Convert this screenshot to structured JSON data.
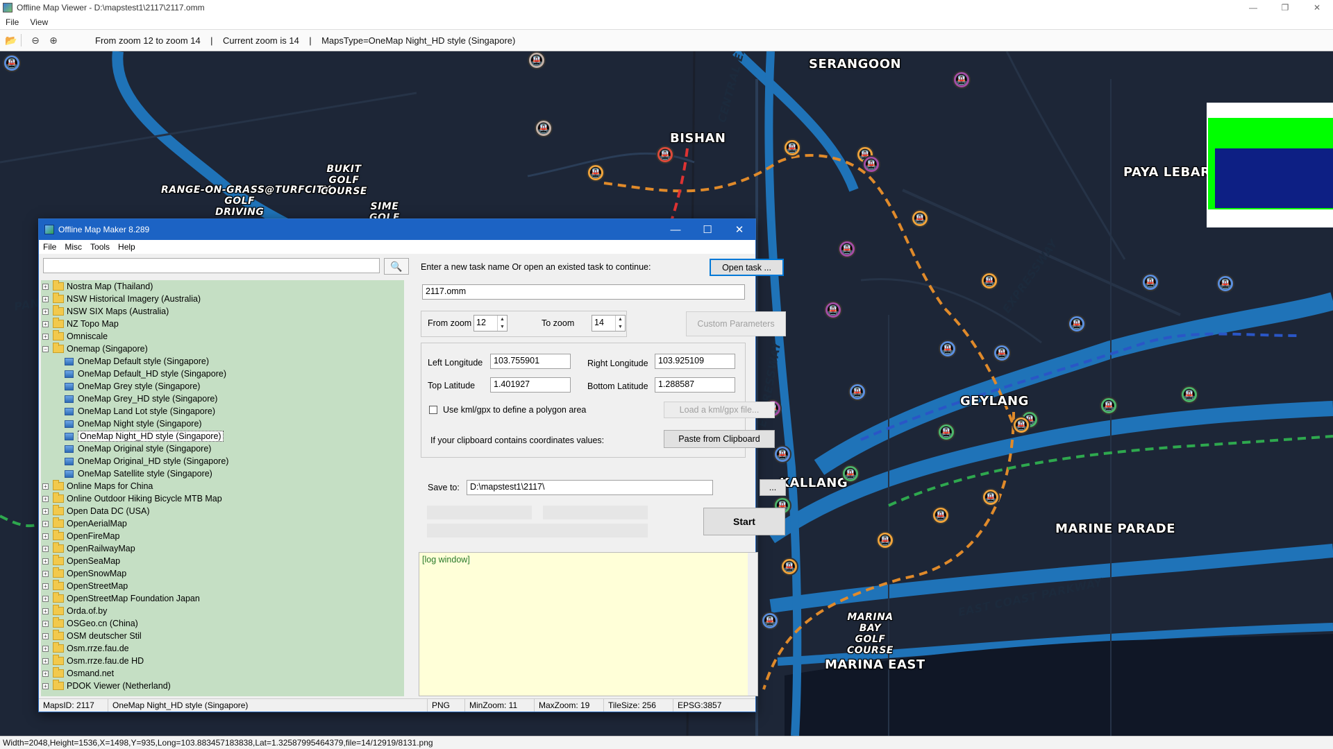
{
  "viewer": {
    "title": "Offline Map Viewer - D:\\mapstest1\\2117\\2117.omm",
    "menu": [
      "File",
      "View"
    ],
    "zoom_info": "From zoom 12 to zoom 14    |    Current zoom is 14    |    MapsType=OneMap Night_HD style (Singapore)",
    "status": "Width=2048,Height=1536,X=1498,Y=935,Long=103.883457183838,Lat=1.32587995464379,file=14/12919/8131.png",
    "window_buttons": [
      "—",
      "❐",
      "✕"
    ]
  },
  "map": {
    "labels": {
      "serangoon": "SERANGOON",
      "bishan": "BISHAN",
      "paya_lebar": "PAYA LEBAR",
      "geylang": "GEYLANG",
      "kallang": "KALLANG",
      "marine_parade": "MARINE PARADE",
      "marina_east": "MARINA EAST",
      "range_on_grass": "RANGE-ON-GRASS@TURFCITY",
      "golf_driving": "GOLF\nDRIVING",
      "bukit_golf": "BUKIT\nGOLF\nCOURSE",
      "sime_golf": "SIME\nGOLF",
      "marina_bay_golf": "MARINA\nBAY\nGOLF\nCOURSE",
      "central_expressway": "CENTRAL EXPRESS",
      "expressway_ne": "EXPRESSWAY",
      "expressway_mid": "EXPRESSWAY",
      "east_coast_parkway": "EAST COAST PARKWAY",
      "pan": "PAN"
    }
  },
  "dialog": {
    "title": "Offline Map Maker 8.289",
    "menu": [
      "File",
      "Misc",
      "Tools",
      "Help"
    ],
    "search_placeholder": "",
    "tree": [
      {
        "label": "Nostra Map (Thailand)",
        "type": "folder"
      },
      {
        "label": "NSW Historical Imagery (Australia)",
        "type": "folder"
      },
      {
        "label": "NSW SIX Maps (Australia)",
        "type": "folder"
      },
      {
        "label": "NZ Topo Map",
        "type": "folder"
      },
      {
        "label": "Omniscale",
        "type": "folder"
      },
      {
        "label": "Onemap (Singapore)",
        "type": "folder-open"
      },
      {
        "label": "OneMap Default style (Singapore)",
        "type": "map"
      },
      {
        "label": "OneMap Default_HD style (Singapore)",
        "type": "map"
      },
      {
        "label": "OneMap Grey style (Singapore)",
        "type": "map"
      },
      {
        "label": "OneMap Grey_HD style (Singapore)",
        "type": "map"
      },
      {
        "label": "OneMap Land Lot style (Singapore)",
        "type": "map"
      },
      {
        "label": "OneMap Night style (Singapore)",
        "type": "map"
      },
      {
        "label": "OneMap Night_HD style (Singapore)",
        "type": "map-selected"
      },
      {
        "label": "OneMap Original style (Singapore)",
        "type": "map"
      },
      {
        "label": "OneMap Original_HD style (Singapore)",
        "type": "map"
      },
      {
        "label": "OneMap Satellite style (Singapore)",
        "type": "map"
      },
      {
        "label": "Online Maps for China",
        "type": "folder"
      },
      {
        "label": "Online Outdoor Hiking Bicycle MTB Map",
        "type": "folder"
      },
      {
        "label": "Open Data DC (USA)",
        "type": "folder"
      },
      {
        "label": "OpenAerialMap",
        "type": "folder"
      },
      {
        "label": "OpenFireMap",
        "type": "folder"
      },
      {
        "label": "OpenRailwayMap",
        "type": "folder"
      },
      {
        "label": "OpenSeaMap",
        "type": "folder"
      },
      {
        "label": "OpenSnowMap",
        "type": "folder"
      },
      {
        "label": "OpenStreetMap",
        "type": "folder"
      },
      {
        "label": "OpenStreetMap Foundation Japan",
        "type": "folder"
      },
      {
        "label": "Orda.of.by",
        "type": "folder"
      },
      {
        "label": "OSGeo.cn (China)",
        "type": "folder"
      },
      {
        "label": "OSM deutscher Stil",
        "type": "folder"
      },
      {
        "label": "Osm.rrze.fau.de",
        "type": "folder"
      },
      {
        "label": "Osm.rrze.fau.de HD",
        "type": "folder"
      },
      {
        "label": "Osmand.net",
        "type": "folder"
      },
      {
        "label": "PDOK Viewer (Netherland)",
        "type": "folder"
      }
    ],
    "task_prompt": "Enter a new task name Or open an existed task to continue:",
    "open_task": "Open task ...",
    "task_name": "2117.omm",
    "from_zoom_label": "From zoom",
    "from_zoom": "12",
    "to_zoom_label": "To zoom",
    "to_zoom": "14",
    "custom_params": "Custom Parameters",
    "left_lon_label": "Left Longitude",
    "left_lon": "103.755901",
    "right_lon_label": "Right Longitude",
    "right_lon": "103.925109",
    "top_lat_label": "Top Latitude",
    "top_lat": "1.401927",
    "bottom_lat_label": "Bottom Latitude",
    "bottom_lat": "1.288587",
    "kml_checkbox": "Use kml/gpx to define a polygon area",
    "load_kml": "Load a kml/gpx file...",
    "clipboard_prompt": "If your clipboard contains coordinates values:",
    "paste_clipboard": "Paste from Clipboard",
    "save_to_label": "Save to:",
    "save_to": "D:\\mapstest1\\2117\\",
    "browse": "...",
    "start": "Start",
    "log": "[log window]",
    "status": {
      "maps_id": "MapsID: 2117",
      "style": "OneMap Night_HD style (Singapore)",
      "format": "PNG",
      "min_zoom": "MinZoom: 11",
      "max_zoom": "MaxZoom: 19",
      "tile_size": "TileSize: 256",
      "epsg": "EPSG:3857"
    }
  }
}
